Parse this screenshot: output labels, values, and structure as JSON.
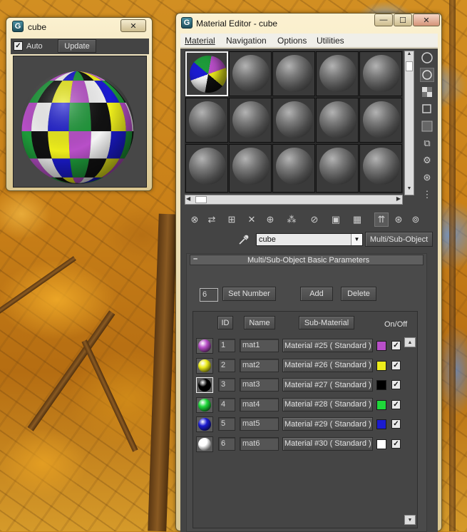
{
  "preview_window": {
    "title": "cube",
    "close_glyph": "✕",
    "auto_label": "Auto",
    "auto_checked": true,
    "update_label": "Update",
    "sphere_colors": [
      "#b84fc8",
      "#ecec1c",
      "#111111",
      "#1e9a3a",
      "#1b1bd0",
      "#f4f4f4"
    ]
  },
  "material_editor": {
    "title": "Material Editor - cube",
    "menu": [
      "Material",
      "Navigation",
      "Options",
      "Utilities"
    ],
    "caption_buttons": {
      "minimize": "—",
      "maximize": "☐",
      "close": "✕"
    },
    "material_name": "cube",
    "material_type": "Multi/Sub-Object",
    "rollout_title": "Multi/Sub-Object Basic Parameters",
    "rollout_toggle": "–",
    "set_number_value": "6",
    "set_number_label": "Set Number",
    "add_label": "Add",
    "delete_label": "Delete",
    "columns": {
      "id": "ID",
      "name": "Name",
      "sub_material": "Sub-Material",
      "on_off": "On/Off"
    },
    "rows": [
      {
        "id": "1",
        "name": "mat1",
        "sub": "Material #25  ( Standard )",
        "color": "#b84fc8",
        "enabled": true
      },
      {
        "id": "2",
        "name": "mat2",
        "sub": "Material #26  ( Standard )",
        "color": "#ecec1c",
        "enabled": true
      },
      {
        "id": "3",
        "name": "mat3",
        "sub": "Material #27  ( Standard )",
        "color": "#000000",
        "enabled": true
      },
      {
        "id": "4",
        "name": "mat4",
        "sub": "Material #28  ( Standard )",
        "color": "#1fd83a",
        "enabled": true
      },
      {
        "id": "5",
        "name": "mat5",
        "sub": "Material #29  ( Standard )",
        "color": "#1b1bd0",
        "enabled": true
      },
      {
        "id": "6",
        "name": "mat6",
        "sub": "Material #30  ( Standard )",
        "color": "#ffffff",
        "enabled": true
      }
    ],
    "side_tools": [
      "sample-type-icon",
      "backlight-icon",
      "background-icon",
      "sample-uv-tiling-icon",
      "video-color-check-icon",
      "make-preview-icon",
      "options-icon",
      "select-by-material-icon",
      "material-map-navigator-icon"
    ],
    "bottom_tools": [
      "get-material-icon",
      "put-to-scene-icon",
      "assign-to-selection-icon",
      "reset-map-icon",
      "make-unique-icon",
      "put-to-library-icon",
      "material-id-channel-icon",
      "show-map-in-viewport-icon",
      "show-end-result-icon",
      "go-to-parent-icon",
      "go-forward-to-sibling-icon",
      "pick-from-object-icon"
    ]
  }
}
